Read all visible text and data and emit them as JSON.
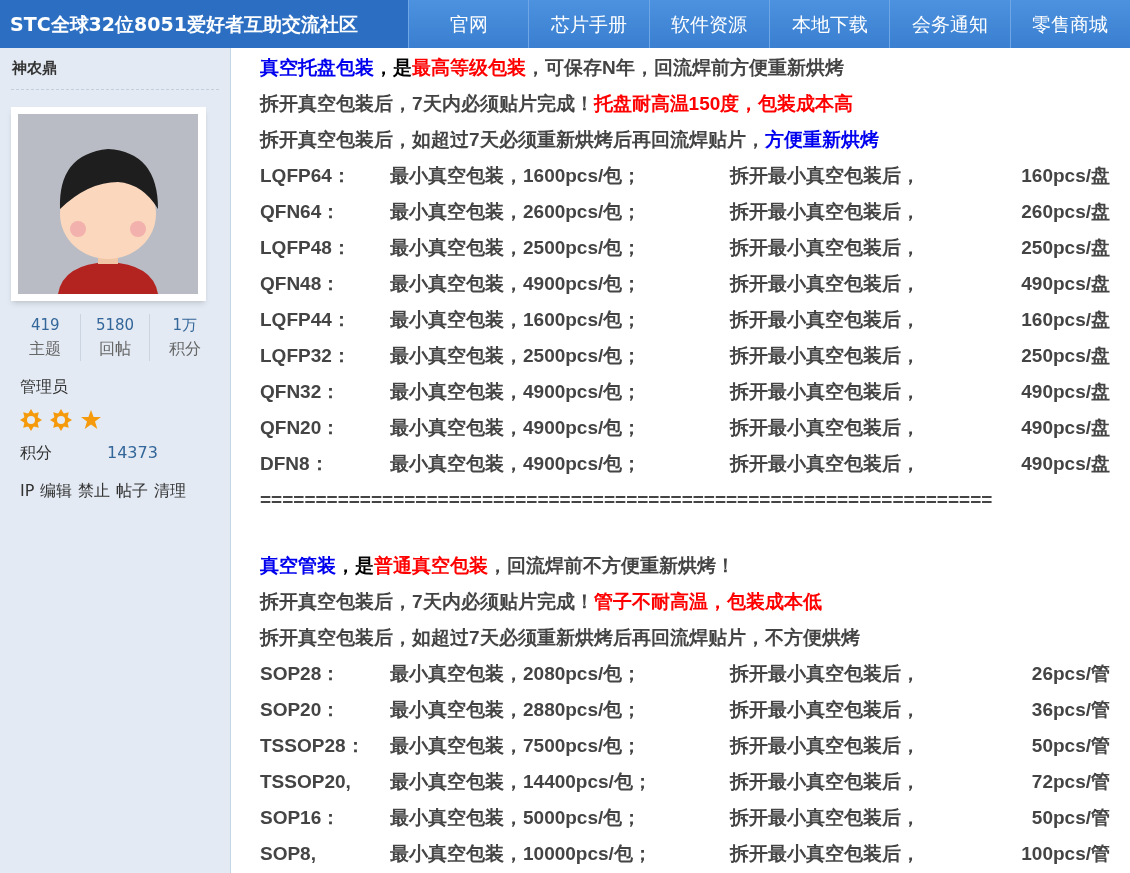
{
  "header": {
    "site_title": "STC全球32位8051爱好者互助交流社区",
    "nav": [
      {
        "label": "官网"
      },
      {
        "label": "芯片手册"
      },
      {
        "label": "软件资源"
      },
      {
        "label": "本地下载"
      },
      {
        "label": "会务通知"
      },
      {
        "label": "零售商城"
      }
    ]
  },
  "author": {
    "name": "神农鼎",
    "avatar": {
      "kind": "picture"
    },
    "stats": [
      {
        "value": "419",
        "label": "主题"
      },
      {
        "value": "5180",
        "label": "回帖"
      },
      {
        "value": "1万",
        "label": "积分"
      }
    ],
    "group": "管理员",
    "rank_icons": [
      {
        "kind": "sun"
      },
      {
        "kind": "sun"
      },
      {
        "kind": "star"
      }
    ],
    "points_label": "积分",
    "points_value": "14373",
    "actions": [
      "IP",
      "编辑",
      "禁止",
      "帖子",
      "清理"
    ]
  },
  "post": {
    "sections": [
      {
        "intro": [
          [
            {
              "text": "真空托盘包装",
              "color": "#0000ee"
            },
            {
              "text": "，是",
              "color": "#000000"
            },
            {
              "text": "最高等级包装",
              "color": "#ff0000"
            },
            {
              "text": "，可保存N年，回流焊前方便重新烘烤",
              "color": "#444444"
            }
          ],
          [
            {
              "text": "拆开真空包装后，7天内必须贴片完成！",
              "color": "#444444"
            },
            {
              "text": "托盘耐高温150度，包装成本高",
              "color": "#ff0000"
            }
          ],
          [
            {
              "text": "拆开真空包装后，如超过7天必须重新烘烤后再回流焊贴片，",
              "color": "#444444"
            },
            {
              "text": "方便重新烘烤",
              "color": "#0000ee"
            }
          ]
        ],
        "rows": [
          {
            "name": "LQFP64：",
            "package": "最小真空包装，1600pcs/包；",
            "after": "拆开最小真空包装后，",
            "qty": "160pcs/盘"
          },
          {
            "name": "QFN64：",
            "package": "最小真空包装，2600pcs/包；",
            "after": "拆开最小真空包装后，",
            "qty": "260pcs/盘"
          },
          {
            "name": "LQFP48：",
            "package": "最小真空包装，2500pcs/包；",
            "after": "拆开最小真空包装后，",
            "qty": "250pcs/盘"
          },
          {
            "name": "QFN48：",
            "package": "最小真空包装，4900pcs/包；",
            "after": "拆开最小真空包装后，",
            "qty": "490pcs/盘"
          },
          {
            "name": "LQFP44：",
            "package": "最小真空包装，1600pcs/包；",
            "after": "拆开最小真空包装后，",
            "qty": "160pcs/盘"
          },
          {
            "name": "LQFP32：",
            "package": "最小真空包装，2500pcs/包；",
            "after": "拆开最小真空包装后，",
            "qty": "250pcs/盘"
          },
          {
            "name": "QFN32：",
            "package": "最小真空包装，4900pcs/包；",
            "after": "拆开最小真空包装后，",
            "qty": "490pcs/盘"
          },
          {
            "name": "QFN20：",
            "package": "最小真空包装，4900pcs/包；",
            "after": "拆开最小真空包装后，",
            "qty": "490pcs/盘"
          },
          {
            "name": "DFN8：",
            "package": "最小真空包装，4900pcs/包；",
            "after": "拆开最小真空包装后，",
            "qty": "490pcs/盘"
          }
        ],
        "separator": "=================================================================="
      },
      {
        "intro": [
          [
            {
              "text": "真空管装",
              "color": "#0000ee"
            },
            {
              "text": "，是",
              "color": "#000000"
            },
            {
              "text": "普通真空包装",
              "color": "#ff0000"
            },
            {
              "text": "，回流焊前不方便重新烘烤！",
              "color": "#444444"
            }
          ],
          [
            {
              "text": "拆开真空包装后，7天内必须贴片完成！",
              "color": "#444444"
            },
            {
              "text": "管子不耐高温，包装成本低",
              "color": "#ff0000"
            }
          ],
          [
            {
              "text": "拆开真空包装后，如超过7天必须重新烘烤后再回流焊贴片，不方便烘烤",
              "color": "#444444"
            }
          ]
        ],
        "rows": [
          {
            "name": "SOP28：",
            "package": "最小真空包装，2080pcs/包；",
            "after": "拆开最小真空包装后，",
            "qty": "26pcs/管"
          },
          {
            "name": "SOP20：",
            "package": "最小真空包装，2880pcs/包；",
            "after": "拆开最小真空包装后，",
            "qty": "36pcs/管"
          },
          {
            "name": "TSSOP28：",
            "package": "最小真空包装，7500pcs/包；",
            "after": "拆开最小真空包装后，",
            "qty": "50pcs/管"
          },
          {
            "name": "TSSOP20,",
            "package": "最小真空包装，14400pcs/包；",
            "after": "拆开最小真空包装后，",
            "qty": "72pcs/管"
          },
          {
            "name": "SOP16：",
            "package": "最小真空包装，5000pcs/包；",
            "after": "拆开最小真空包装后，",
            "qty": "50pcs/管"
          },
          {
            "name": "SOP8,",
            "package": "最小真空包装，10000pcs/包；",
            "after": "拆开最小真空包装后，",
            "qty": "100pcs/管"
          }
        ]
      }
    ]
  }
}
